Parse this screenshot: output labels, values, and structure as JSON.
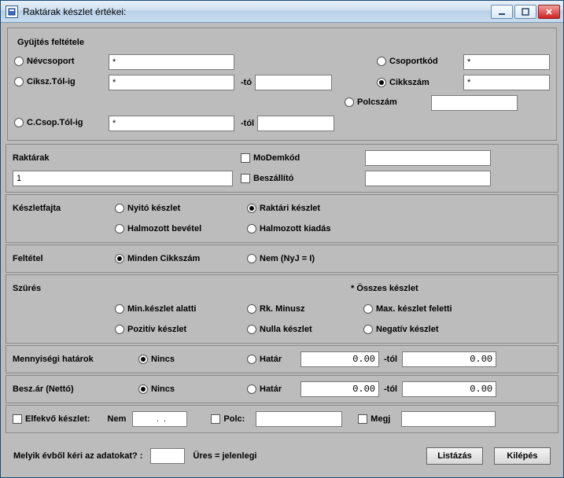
{
  "title": "Raktárak készlet értékei:",
  "group": {
    "title": "Gyüjtés feltétele",
    "nevcsoport": {
      "label": "Névcsoport",
      "value": "*"
    },
    "ciksz": {
      "label": "Ciksz.Tól-ig",
      "from": "*",
      "to_suffix": "-tó",
      "to": ""
    },
    "ccsop": {
      "label": "C.Csop.Tól-ig",
      "from": "*",
      "tol_suffix": "-tól",
      "to": ""
    },
    "csoportkod": {
      "label": "Csoportkód",
      "value": "*"
    },
    "cikkszam": {
      "label": "Cikkszám",
      "value": "*"
    },
    "polcszam": {
      "label": "Polcszám",
      "value": ""
    }
  },
  "raktarak": {
    "label": "Raktárak",
    "value": "1",
    "modemkod": "MoDemkód",
    "beszallito": "Beszállító"
  },
  "keszletfajta": {
    "label": "Készletfajta",
    "nyito": "Nyitó készlet",
    "raktari": "Raktári készlet",
    "halm_bev": "Halmozott bevétel",
    "halm_kiad": "Halmozott kiadás"
  },
  "feltetel": {
    "label": "Feltétel",
    "minden": "Minden Cikkszám",
    "nem": "Nem (NyJ = I)"
  },
  "szures": {
    "label": "Szürés",
    "osszes": "* Összes készlet",
    "min": "Min.készlet alatti",
    "rkmin": "Rk. Minusz",
    "max": "Max. készlet feletti",
    "poz": "Pozitív készlet",
    "nulla": "Nulla készlet",
    "neg": "Negatív készlet"
  },
  "menny": {
    "label": "Mennyiségi határok",
    "nincs": "Nincs",
    "hatar": "Határ",
    "v1": "0.00",
    "tol": "-tól",
    "v2": "0.00"
  },
  "beszar": {
    "label": "Besz.ár (Nettó)",
    "nincs": "Nincs",
    "hatar": "Határ",
    "v1": "0.00",
    "tol": "-tól",
    "v2": "0.00"
  },
  "bottom": {
    "elfekvo": "Elfekvő készlet:",
    "nem": "Nem",
    "dateval": " .  .",
    "polc": "Polc:",
    "megj": "Megj"
  },
  "footer": {
    "question": "Melyik évből kéri az adatokat? :",
    "hint": "Üres = jelenlegi",
    "listazas": "Listázás",
    "kilepes": "Kilépés"
  }
}
